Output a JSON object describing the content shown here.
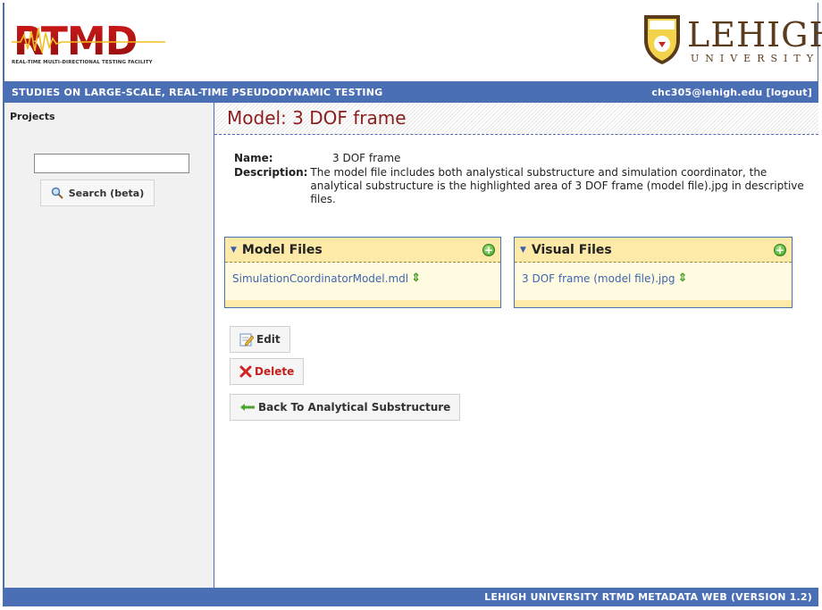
{
  "header": {
    "rtmd_subtitle": "REAL-TIME MULTI-DIRECTIONAL TESTING FACILITY",
    "lehigh_name": "LEHIGH",
    "lehigh_university": "UNIVERSITY"
  },
  "topbar": {
    "title": "STUDIES ON LARGE-SCALE, REAL-TIME PSEUDODYNAMIC TESTING",
    "user": "chc305@lehigh.edu",
    "logout": "[logout]"
  },
  "sidebar": {
    "title": "Projects",
    "search_value": "",
    "search_label": "Search (beta)"
  },
  "main": {
    "title": "Model: 3 DOF frame",
    "name_label": "Name:",
    "name_value": "3 DOF frame",
    "description_label": "Description:",
    "description_value": "The model file includes both analystical substructure and simulation coordinator, the analytical substructure is the highlighted area of 3 DOF frame (model file).jpg in descriptive files."
  },
  "panels": {
    "model_files": {
      "title": "Model Files",
      "file": "SimulationCoordinatorModel.mdl"
    },
    "visual_files": {
      "title": "Visual Files",
      "file": "3 DOF frame (model file).jpg"
    }
  },
  "buttons": {
    "edit": "Edit",
    "delete": "Delete",
    "back": "Back To Analytical Substructure"
  },
  "footer": {
    "text": "LEHIGH UNIVERSITY RTMD METADATA WEB (VERSION 1.2)"
  },
  "colors": {
    "accent": "#4a6fb5",
    "title_red": "#8a1d1d",
    "panel_header": "#fde9a8",
    "panel_body": "#fffbe0"
  },
  "icons": [
    "rtmd-logo",
    "lehigh-shield-icon",
    "search-icon",
    "expand-triangle-icon",
    "add-circle-icon",
    "reorder-arrows-icon",
    "edit-icon",
    "delete-x-icon",
    "back-arrow-icon"
  ]
}
